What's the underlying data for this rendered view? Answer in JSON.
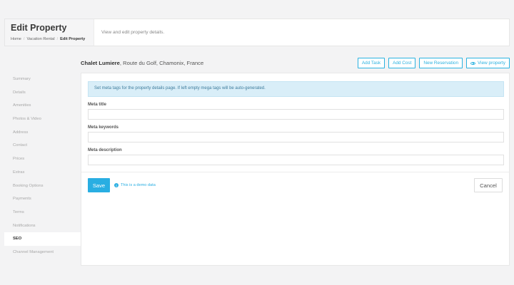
{
  "header": {
    "title": "Edit Property",
    "description": "View and edit property details.",
    "breadcrumb": [
      "Home",
      "Vacation Rental",
      "Edit Property"
    ]
  },
  "property": {
    "name": "Chalet Lumiere",
    "address": ", Route du Golf, Chamonix, France"
  },
  "actions": {
    "add_task": "Add Task",
    "add_cost": "Add Cost",
    "new_reservation": "New Reservation",
    "view_property": "View property"
  },
  "sidebar": {
    "items": [
      {
        "label": "Summary"
      },
      {
        "label": "Details"
      },
      {
        "label": "Amenities"
      },
      {
        "label": "Photos & Video"
      },
      {
        "label": "Address"
      },
      {
        "label": "Contact"
      },
      {
        "label": "Prices"
      },
      {
        "label": "Extras"
      },
      {
        "label": "Booking Options"
      },
      {
        "label": "Payments"
      },
      {
        "label": "Terms"
      },
      {
        "label": "Notifications"
      },
      {
        "label": "SEO",
        "active": true
      },
      {
        "label": "Channel Management"
      }
    ]
  },
  "seo": {
    "info": "Set meta tags for the property details page. If left empty mega tags will be auto-generated.",
    "meta_title_label": "Meta title",
    "meta_title_value": "",
    "meta_keywords_label": "Meta keywords",
    "meta_keywords_value": "",
    "meta_description_label": "Meta description",
    "meta_description_value": "",
    "save": "Save",
    "demo_note": "This is a demo data",
    "cancel": "Cancel"
  }
}
